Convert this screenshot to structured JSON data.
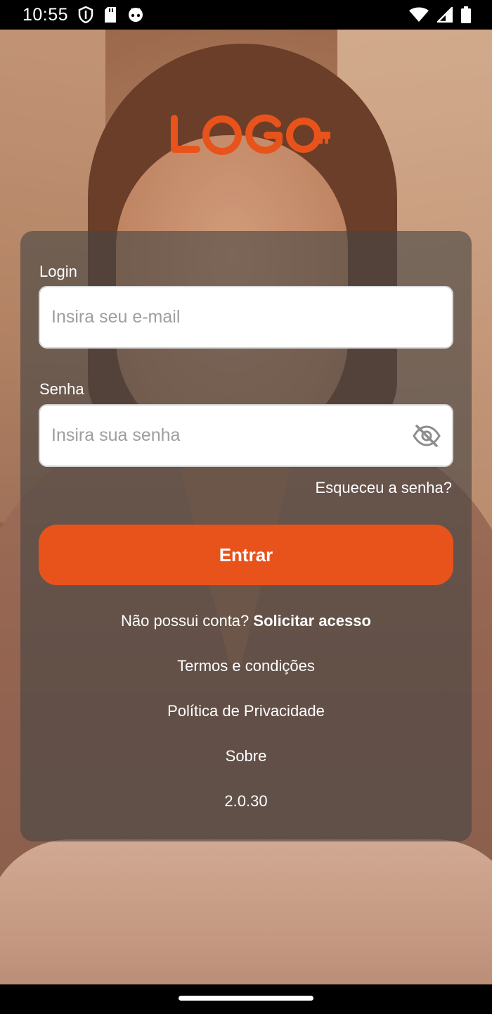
{
  "status_bar": {
    "time": "10:55",
    "left_icons": [
      "shield-icon",
      "sd-card-icon",
      "cat-face-icon"
    ],
    "right_icons": [
      "wifi-icon",
      "signal-icon",
      "battery-icon"
    ]
  },
  "logo": {
    "text": "LOGO",
    "color": "#e8531c"
  },
  "form": {
    "login_label": "Login",
    "login_placeholder": "Insira seu e-mail",
    "password_label": "Senha",
    "password_placeholder": "Insira sua senha",
    "password_toggle_icon": "eye-off-icon",
    "forgot_password": "Esqueceu a senha?",
    "submit_label": "Entrar",
    "submit_color": "#e8531c"
  },
  "links": {
    "no_account": "Não possui conta?",
    "request_access": "Solicitar acesso",
    "terms": "Termos e condições",
    "privacy": "Política de Privacidade",
    "about": "Sobre",
    "version": "2.0.30"
  }
}
